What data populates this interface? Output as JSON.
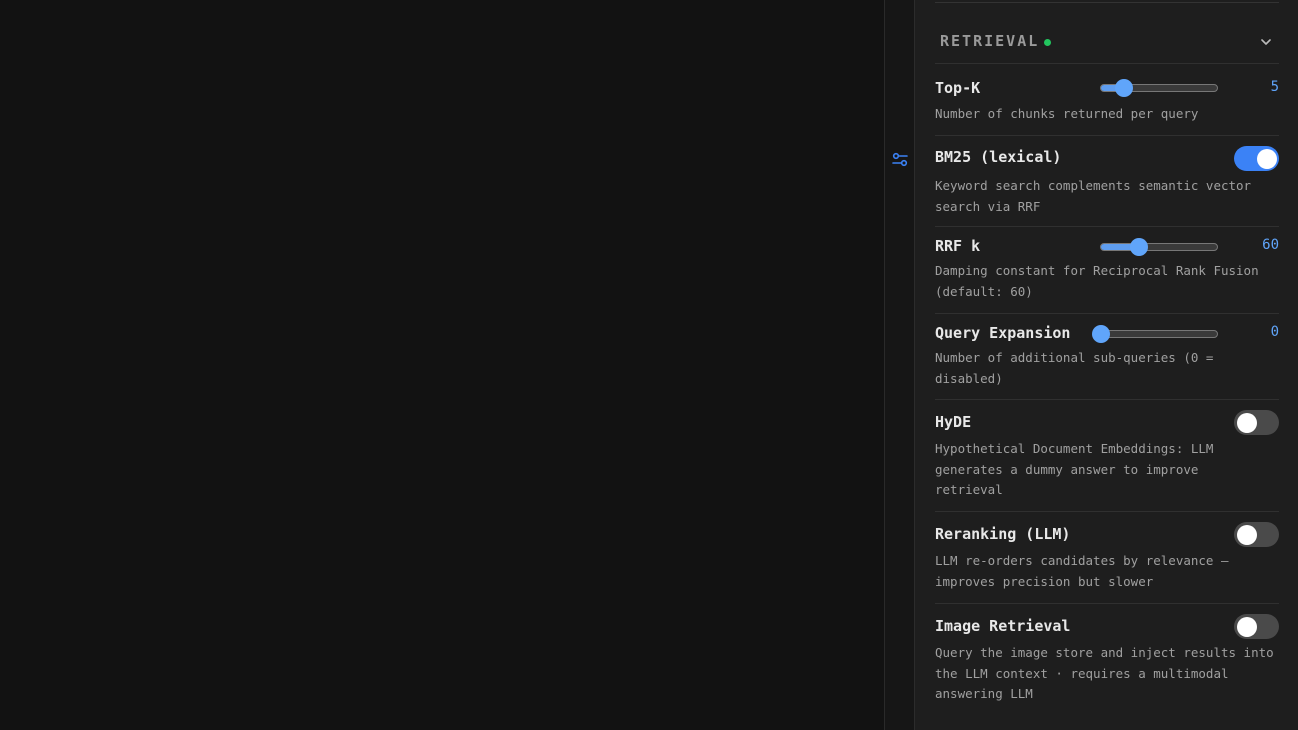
{
  "section": {
    "title": "RETRIEVAL",
    "status_color": "#22c55e",
    "icon": "chevron-down-icon"
  },
  "rail": {
    "icon": "sliders-icon"
  },
  "settings": {
    "top_k": {
      "label": "Top-K",
      "value": "5",
      "fraction": 0.2,
      "description": "Number of chunks returned per query"
    },
    "bm25": {
      "label": "BM25 (lexical)",
      "enabled": true,
      "description": "Keyword search complements semantic vector search via RRF"
    },
    "rrf_k": {
      "label": "RRF k",
      "value": "60",
      "fraction": 0.33,
      "description": "Damping constant for Reciprocal Rank Fusion (default: 60)"
    },
    "query_expansion": {
      "label": "Query Expansion",
      "value": "0",
      "fraction": 0.0,
      "description": "Number of additional sub-queries (0 = disabled)"
    },
    "hyde": {
      "label": "HyDE",
      "enabled": false,
      "description": "Hypothetical Document Embeddings: LLM generates a dummy answer to improve retrieval"
    },
    "reranking": {
      "label": "Reranking (LLM)",
      "enabled": false,
      "description": "LLM re-orders candidates by relevance — improves precision but slower"
    },
    "image_retrieval": {
      "label": "Image Retrieval",
      "enabled": false,
      "description": "Query the image store and inject results into the LLM context · requires a multimodal answering LLM"
    }
  }
}
